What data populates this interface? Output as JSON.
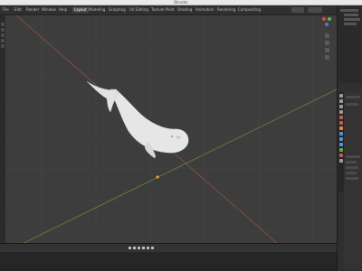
{
  "window": {
    "title": "Blender"
  },
  "menus": [
    {
      "label": "File"
    },
    {
      "label": "Edit"
    },
    {
      "label": "Render"
    },
    {
      "label": "Window"
    },
    {
      "label": "Help"
    },
    {
      "label": "Layout",
      "active": true
    },
    {
      "label": "Modeling"
    },
    {
      "label": "Sculpting"
    },
    {
      "label": "UV Editing"
    },
    {
      "label": "Texture Paint"
    },
    {
      "label": "Shading"
    },
    {
      "label": "Animation"
    },
    {
      "label": "Rendering"
    },
    {
      "label": "Compositing"
    }
  ],
  "icons": {
    "axis_x_color": "#d44b4b",
    "axis_y_color": "#79a83c",
    "axis_z_color": "#4a7fd0",
    "viewport_bg": "#3d3d3d",
    "model": "whale-model"
  },
  "statusbar": {
    "text": ""
  }
}
